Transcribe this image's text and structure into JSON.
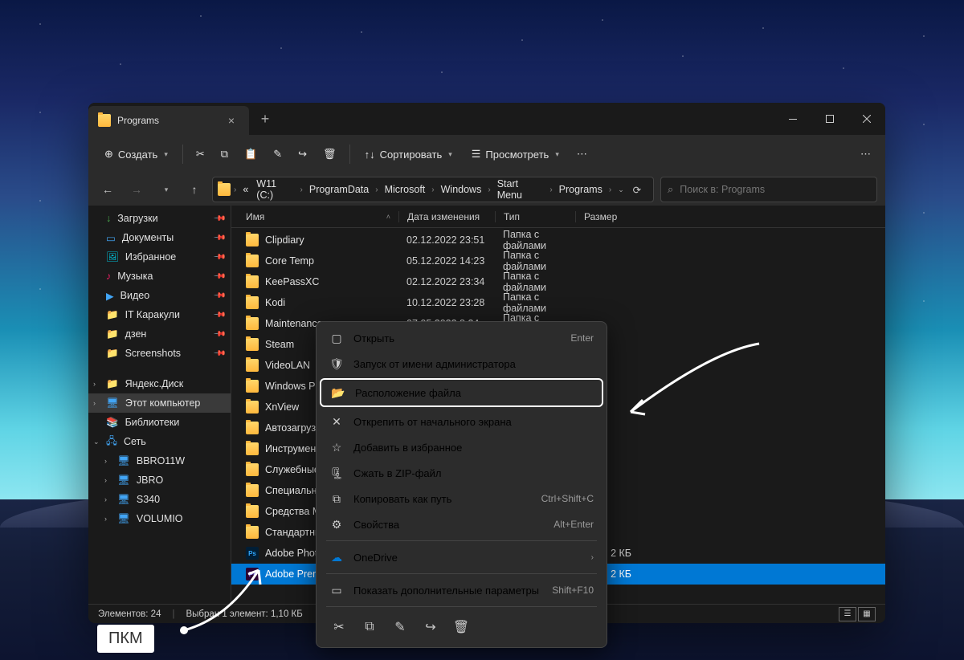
{
  "tab": {
    "title": "Programs"
  },
  "toolbar": {
    "create": "Создать",
    "sort": "Сортировать",
    "view": "Просмотреть"
  },
  "breadcrumb": {
    "prefix": "«",
    "segs": [
      "W11 (C:)",
      "ProgramData",
      "Microsoft",
      "Windows",
      "Start Menu",
      "Programs"
    ]
  },
  "search": {
    "placeholder": "Поиск в: Programs"
  },
  "sidebar": {
    "quick": [
      {
        "label": "Загрузки",
        "ico": "↓",
        "cls": "ico-green",
        "pin": true
      },
      {
        "label": "Документы",
        "ico": "▭",
        "cls": "ico-blue",
        "pin": true
      },
      {
        "label": "Избранное",
        "ico": "🖼",
        "cls": "ico-teal",
        "pin": true
      },
      {
        "label": "Музыка",
        "ico": "♪",
        "cls": "ico-pink",
        "pin": true
      },
      {
        "label": "Видео",
        "ico": "▶",
        "cls": "ico-blue",
        "pin": true
      },
      {
        "label": "IT Каракули",
        "ico": "📁",
        "cls": "ico-yellow",
        "pin": true
      },
      {
        "label": "дзен",
        "ico": "📁",
        "cls": "ico-yellow",
        "pin": true
      },
      {
        "label": "Screenshots",
        "ico": "📁",
        "cls": "ico-yellow",
        "pin": true
      }
    ],
    "yandex": "Яндекс.Диск",
    "thispc": "Этот компьютер",
    "libs": "Библиотеки",
    "network": "Сеть",
    "nethosts": [
      "BBRO11W",
      "JBRO",
      "S340",
      "VOLUMIO"
    ]
  },
  "columns": {
    "name": "Имя",
    "date": "Дата изменения",
    "type": "Тип",
    "size": "Размер"
  },
  "rows": [
    {
      "name": "Clipdiary",
      "date": "02.12.2022 23:51",
      "type": "Папка с файлами",
      "kind": "folder"
    },
    {
      "name": "Core Temp",
      "date": "05.12.2022 14:23",
      "type": "Папка с файлами",
      "kind": "folder"
    },
    {
      "name": "KeePassXC",
      "date": "02.12.2022 23:34",
      "type": "Папка с файлами",
      "kind": "folder"
    },
    {
      "name": "Kodi",
      "date": "10.12.2022 23:28",
      "type": "Папка с файлами",
      "kind": "folder"
    },
    {
      "name": "Maintenance",
      "date": "07.05.2022 8:24",
      "type": "Папка с файлами",
      "kind": "folder"
    },
    {
      "name": "Steam",
      "date": "",
      "type": "",
      "kind": "folder"
    },
    {
      "name": "VideoLAN",
      "date": "",
      "type": "",
      "kind": "folder"
    },
    {
      "name": "Windows Pow",
      "date": "",
      "type": "",
      "kind": "folder"
    },
    {
      "name": "XnView",
      "date": "",
      "type": "",
      "kind": "folder"
    },
    {
      "name": "Автозагрузка",
      "date": "",
      "type": "",
      "kind": "folder"
    },
    {
      "name": "Инструменты",
      "date": "",
      "type": "",
      "kind": "folder"
    },
    {
      "name": "Служебные —",
      "date": "",
      "type": "",
      "kind": "folder"
    },
    {
      "name": "Специальные",
      "date": "",
      "type": "",
      "kind": "folder"
    },
    {
      "name": "Средства Mic",
      "date": "",
      "type": "",
      "kind": "folder"
    },
    {
      "name": "Стандартные",
      "date": "",
      "type": "",
      "kind": "folder"
    },
    {
      "name": "Adobe Photos",
      "date": "",
      "type": "",
      "size": "2 КБ",
      "kind": "ps"
    },
    {
      "name": "Adobe Premie",
      "date": "",
      "type": "",
      "size": "2 КБ",
      "kind": "pr",
      "sel": true
    }
  ],
  "status": {
    "count": "Элементов: 24",
    "sel": "Выбран 1 элемент: 1,10 КБ"
  },
  "ctx": {
    "open": "Открыть",
    "open_s": "Enter",
    "runas": "Запуск от имени администратора",
    "loc": "Расположение файла",
    "unpin": "Открепить от начального экрана",
    "fav": "Добавить в избранное",
    "zip": "Сжать в ZIP-файл",
    "copypath": "Копировать как путь",
    "copypath_s": "Ctrl+Shift+C",
    "props": "Свойства",
    "props_s": "Alt+Enter",
    "onedrive": "OneDrive",
    "more": "Показать дополнительные параметры",
    "more_s": "Shift+F10"
  },
  "pkm": "ПКМ"
}
